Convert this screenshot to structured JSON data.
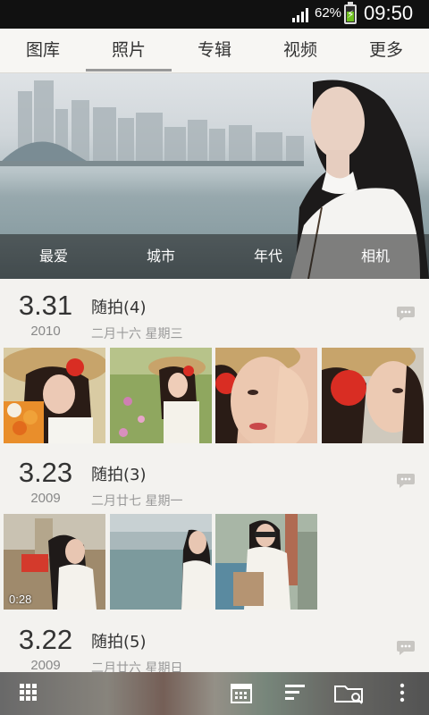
{
  "status_bar": {
    "battery_pct": "62%",
    "time": "09:50"
  },
  "tabs": [
    {
      "label": "图库"
    },
    {
      "label": "照片"
    },
    {
      "label": "专辑"
    },
    {
      "label": "视频"
    },
    {
      "label": "更多"
    }
  ],
  "active_tab": "照片",
  "hero": {
    "categories": [
      {
        "label": "最爱"
      },
      {
        "label": "城市"
      },
      {
        "label": "年代"
      },
      {
        "label": "相机"
      }
    ]
  },
  "groups": [
    {
      "date": "3.31",
      "year": "2010",
      "title": "随拍(4)",
      "subtitle": "二月十六 星期三",
      "count": 4
    },
    {
      "date": "3.23",
      "year": "2009",
      "title": "随拍(3)",
      "subtitle": "二月廿七 星期一",
      "count": 3,
      "video_duration": "0:28"
    },
    {
      "date": "3.22",
      "year": "2009",
      "title": "随拍(5)",
      "subtitle": "二月廿六 星期日",
      "count": 5
    }
  ],
  "bottom_bar": {
    "icons": [
      "grid-view-icon",
      "calendar-icon",
      "sort-icon",
      "folder-icon",
      "overflow-menu-icon"
    ]
  },
  "colors": {
    "background": "#f3f2ef",
    "status_bar": "#111111",
    "battery": "#6ec11f"
  }
}
